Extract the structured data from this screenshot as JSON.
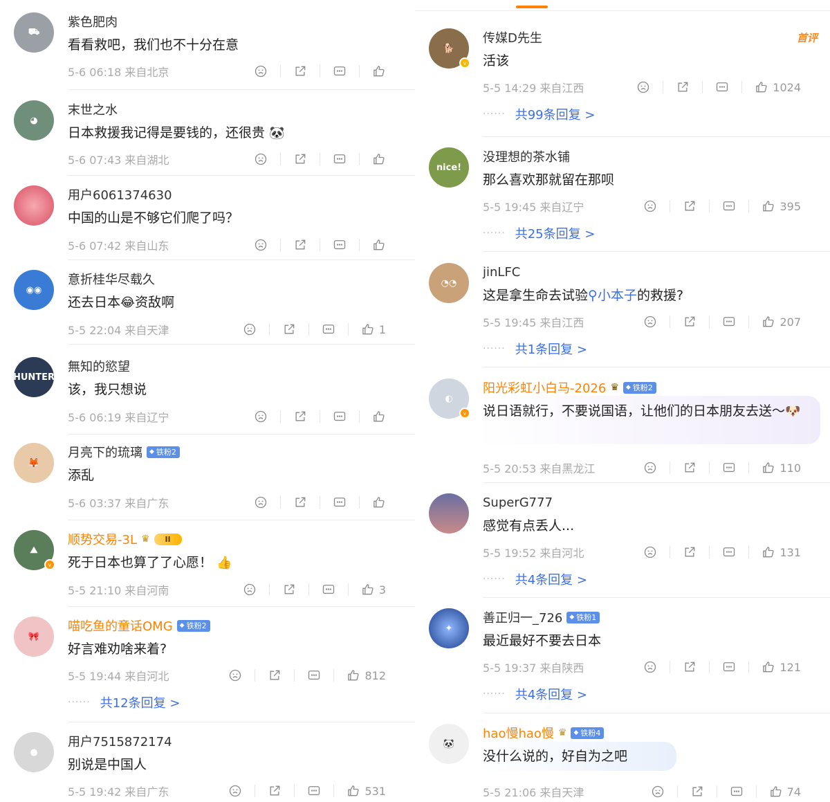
{
  "left": [
    {
      "name": "紫色肥肉",
      "text": "看看救吧，我们也不十分在意",
      "meta": "5-6 06:18  来自北京",
      "likes": "",
      "avatar_color": "#9aa0a6"
    },
    {
      "name": "末世之水",
      "text": "日本救援我记得是要钱的，还很贵",
      "meta": "5-6 07:43  来自湖北",
      "likes": "",
      "avatar_color": "#6f8f7a"
    },
    {
      "name": "用户6061374630",
      "text": "中国的山是不够它们爬了吗？",
      "meta": "5-6 07:42  来自山东",
      "likes": "",
      "avatar_color": "#e2707e"
    },
    {
      "name": "意折桂华尽载久",
      "text_before": "还去日本",
      "text_after": "资敌啊",
      "meta": "5-5 22:04  来自天津",
      "likes": "1",
      "avatar_color": "#3a7bd5"
    },
    {
      "name": "無知的慾望",
      "text": "该，我只想说",
      "meta": "5-6 06:19  来自辽宁",
      "likes": "",
      "avatar_color": "#2b3a55"
    },
    {
      "name": "月亮下的琉璃",
      "fan": "铁粉2",
      "text": "添乱",
      "meta": "5-6 03:37  来自广东",
      "likes": "",
      "avatar_color": "#e8c9a8"
    },
    {
      "name": "顺势交易-3L",
      "level": "II",
      "text": "死于日本也算了了心愿！",
      "meta": "5-5 21:10  来自河南",
      "likes": "3",
      "avatar_color": "#5a7d5a"
    },
    {
      "name": "喵吃鱼的童话OMG",
      "fan": "铁粉2",
      "text": "好言难劝啥来着?",
      "meta": "5-5 19:44  来自河北",
      "likes": "812",
      "replies": "共12条回复 >",
      "avatar_color": "#f0c4c4"
    },
    {
      "name": "用户7515872174",
      "text": "别说是中国人",
      "meta": "5-5 19:42  来自广东",
      "likes": "531",
      "avatar_color": "#d8d8d8"
    }
  ],
  "right": [
    {
      "name": "传媒D先生",
      "text": "活该",
      "meta": "5-5 14:29  来自江西",
      "likes": "1024",
      "replies": "共99条回复 >",
      "tag": "首评",
      "avatar_color": "#8a6d4a"
    },
    {
      "name": "没理想的茶水铺",
      "text": "那么喜欢那就留在那呗",
      "meta": "5-5 19:45  来自辽宁",
      "likes": "395",
      "replies": "共25条回复 >",
      "avatar_color": "#7d9b4a",
      "avatar_text": "nice!"
    },
    {
      "name": "jinLFC",
      "text_before": "这是拿生命去试验",
      "link": "小本子",
      "text_after": "的救援?",
      "meta": "5-5 19:45  来自江西",
      "likes": "207",
      "replies": "共1条回复 >",
      "avatar_color": "#c9a27a"
    },
    {
      "name": "阳光彩虹小白马-2026",
      "fan": "铁粉2",
      "text": "说日语就行，不要说国语，让他们的日本朋友去送～",
      "meta": "5-5 20:53  来自黑龙江",
      "likes": "110",
      "avatar_color": "#cfd6df"
    },
    {
      "name": "SuperG777",
      "text": "感觉有点丢人...",
      "meta": "5-5 19:52  来自河北",
      "likes": "131",
      "replies": "共4条回复 >",
      "avatar_color": "#6a6fa0"
    },
    {
      "name": "善正归一_726",
      "fan": "铁粉1",
      "text": "最近最好不要去日本",
      "meta": "5-5 19:37  来自陕西",
      "likes": "121",
      "replies": "共4条回复 >",
      "avatar_color": "#1d3d8a"
    },
    {
      "name": "hao慢hao慢",
      "fan": "铁粉4",
      "text": "没什么说的，好自为之吧",
      "meta": "5-5 21:06  来自天津",
      "likes": "74",
      "avatar_color": "#444"
    }
  ],
  "icons": [
    "dislike-icon",
    "share-icon",
    "comment-icon",
    "like-icon"
  ],
  "colors": {
    "accent": "#ff8200",
    "link": "#3d6fe0",
    "meta": "#aaaaaa",
    "fan_badge": "#5b8fe8"
  }
}
